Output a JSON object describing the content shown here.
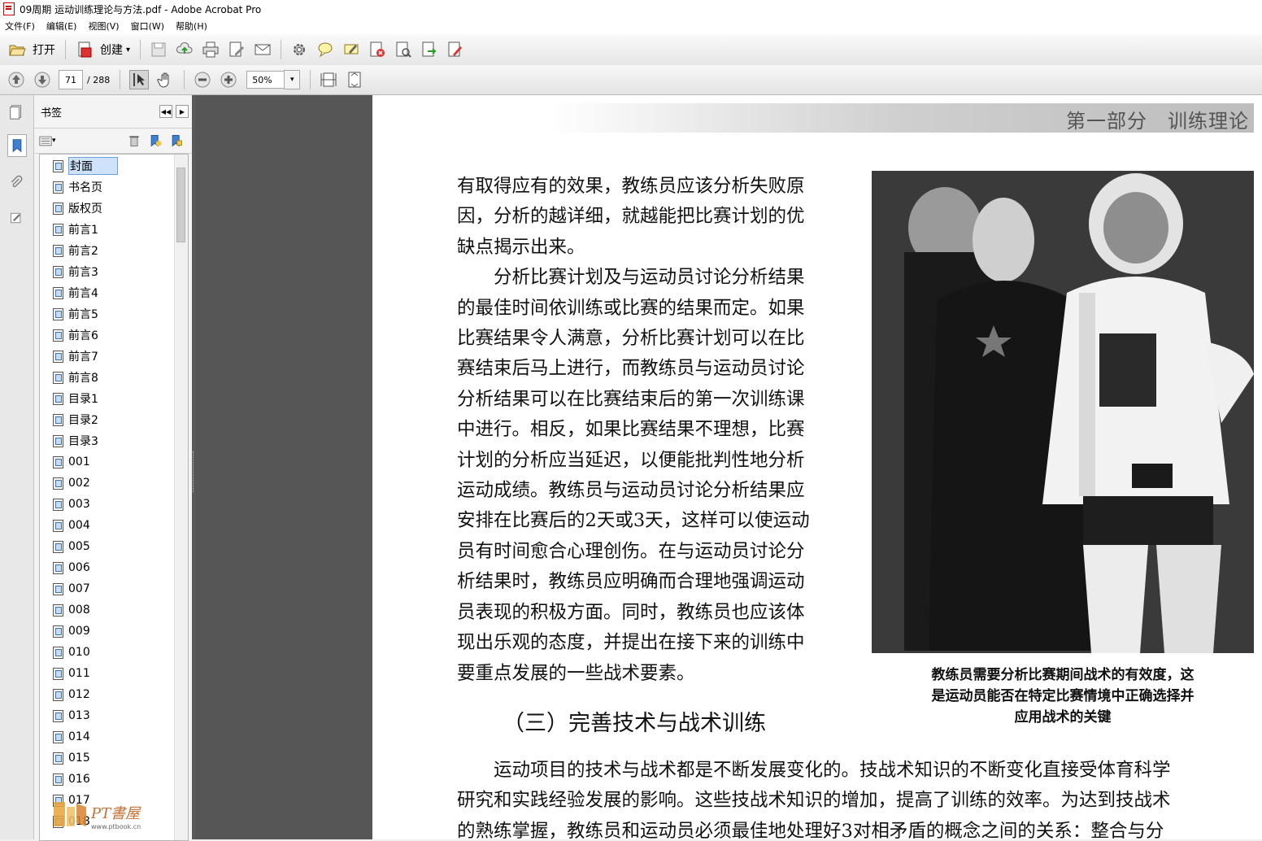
{
  "window": {
    "title": "09周期 运动训练理论与方法.pdf - Adobe Acrobat Pro"
  },
  "menu": [
    "文件(F)",
    "编辑(E)",
    "视图(V)",
    "窗口(W)",
    "帮助(H)"
  ],
  "toolbar": {
    "open_label": "打开",
    "create_label": "创建",
    "create_arrow": "▾",
    "page_current": "71",
    "page_total": "/ 288",
    "zoom": "50%",
    "zoom_arrow": "▾"
  },
  "bookmarks_panel": {
    "title": "书签",
    "collapse": "◀◀",
    "close": "▶",
    "options": "▾",
    "selected": "封面",
    "items": [
      "封面",
      "书名页",
      "版权页",
      "前言1",
      "前言2",
      "前言3",
      "前言4",
      "前言5",
      "前言6",
      "前言7",
      "前言8",
      "目录1",
      "目录2",
      "目录3",
      "001",
      "002",
      "003",
      "004",
      "005",
      "006",
      "007",
      "008",
      "009",
      "010",
      "011",
      "012",
      "013",
      "014",
      "015",
      "016",
      "017",
      "018"
    ]
  },
  "page": {
    "header": "第一部分　训练理论",
    "col_lines": [
      "有取得应有的效果，教练员应该分析失败原",
      "因，分析的越详细，就越能把比赛计划的优",
      "缺点揭示出来。",
      "　　分析比赛计划及与运动员讨论分析结果",
      "的最佳时间依训练或比赛的结果而定。如果",
      "比赛结果令人满意，分析比赛计划可以在比",
      "赛结束后马上进行，而教练员与运动员讨论",
      "分析结果可以在比赛结束后的第一次训练课",
      "中进行。相反，如果比赛结果不理想，比赛",
      "计划的分析应当延迟，以便能批判性地分析",
      "运动成绩。教练员与运动员讨论分析结果应",
      "安排在比赛后的2天或3天，这样可以使运动",
      "员有时间愈合心理创伤。在与运动员讨论分",
      "析结果时，教练员应明确而合理地强调运动",
      "员表现的积极方面。同时，教练员也应该体",
      "现出乐观的态度，并提出在接下来的训练中",
      "要重点发展的一些战术要素。"
    ],
    "caption_lines": [
      "教练员需要分析比赛期间战术的有效度，这",
      "是运动员能否在特定比赛情境中正确选择并",
      "应用战术的关键"
    ],
    "section_heading": "（三）完善技术与战术训练",
    "body_lines": [
      "　　运动项目的技术与战术都是不断发展变化的。技战术知识的不断变化直接受体育科学",
      "研究和实践经验发展的影响。这些技战术知识的增加，提高了训练的效率。为达到技战术",
      "的熟练掌握，教练员和运动员必须最佳地处理好3对相矛盾的概念之间的关系：整合与分"
    ]
  },
  "watermark": {
    "text": "PT書屋",
    "url": "www.ptbook.cn"
  }
}
